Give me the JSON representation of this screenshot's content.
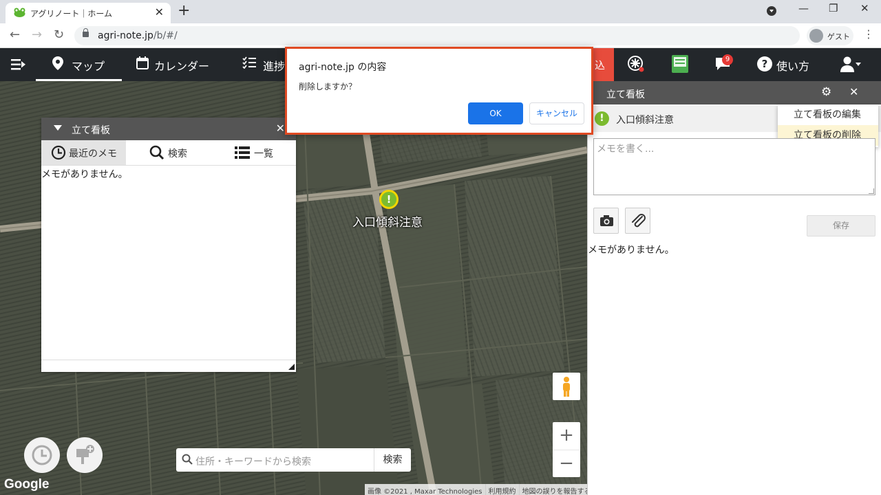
{
  "browser": {
    "tab_title": "アグリノート｜ホーム",
    "tab_close": "✕",
    "new_tab": "+",
    "url_host": "agri-note.jp",
    "url_path": "/b/#/",
    "guest_label": "ゲスト",
    "window_controls": [
      "—",
      "❐",
      "✕"
    ]
  },
  "nav": {
    "items": [
      {
        "label": "マップ",
        "icon": "map-pin-icon",
        "active": true
      },
      {
        "label": "カレンダー",
        "icon": "calendar-icon",
        "active": false
      },
      {
        "label": "進捗",
        "icon": "checklist-icon",
        "active": false
      }
    ],
    "red_label": "込",
    "message_badge": "9",
    "help_label": "使い方"
  },
  "dialog": {
    "title": "agri-note.jp の内容",
    "message": "削除しますか？",
    "ok_label": "OK",
    "cancel_label": "キャンセル"
  },
  "left_panel": {
    "title": "立て看板",
    "tabs": [
      {
        "label": "最近のメモ",
        "icon": "clock-icon"
      },
      {
        "label": "検索",
        "icon": "search-icon"
      },
      {
        "label": "一覧",
        "icon": "list-icon"
      }
    ],
    "empty_text": "メモがありません。"
  },
  "map": {
    "marker_label": "入口傾斜注意",
    "marker_glyph": "!",
    "search_placeholder": "住所・キーワードから検索",
    "search_button": "検索",
    "zoom_in": "+",
    "zoom_out": "−",
    "google_logo": "Google",
    "attribution": [
      "画像 ©2021 , Maxar Technologies",
      "利用規約",
      "地図の誤りを報告する"
    ]
  },
  "right_panel": {
    "title": "立て看板",
    "sign_name": "入口傾斜注意",
    "menu": [
      "立て看板の編集",
      "立て看板の削除"
    ],
    "memo_placeholder": "メモを書く...",
    "save_label": "保存",
    "empty_text": "メモがありません。"
  },
  "colors": {
    "accent_green": "#7cbb2f",
    "dialog_border": "#e04a23",
    "ok_blue": "#1a73e8",
    "nav_bg": "#23272b"
  }
}
